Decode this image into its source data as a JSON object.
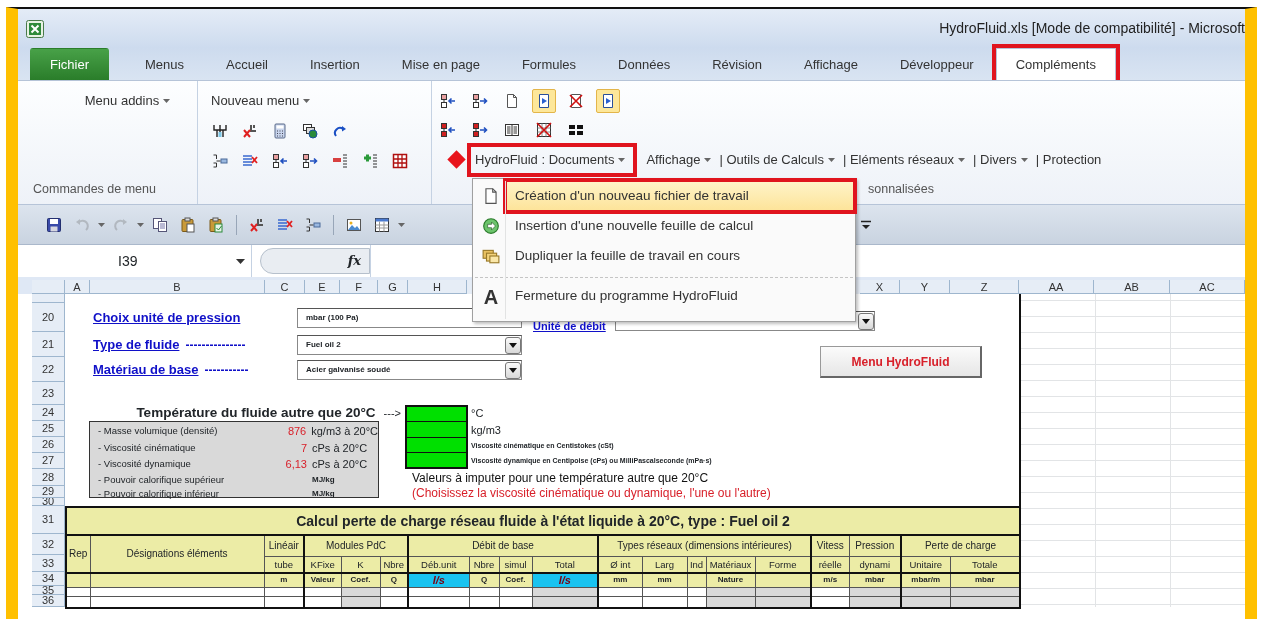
{
  "window": {
    "title": "HydroFluid.xls  [Mode de compatibilité]  -  Microsoft"
  },
  "tabs": [
    {
      "label": "Fichier",
      "kind": "file",
      "selected": false,
      "annotated": false
    },
    {
      "label": "Menus",
      "kind": "tab",
      "selected": false,
      "annotated": false
    },
    {
      "label": "Accueil",
      "kind": "tab",
      "selected": false,
      "annotated": false
    },
    {
      "label": "Insertion",
      "kind": "tab",
      "selected": false,
      "annotated": false
    },
    {
      "label": "Mise en page",
      "kind": "tab",
      "selected": false,
      "annotated": false
    },
    {
      "label": "Formules",
      "kind": "tab",
      "selected": false,
      "annotated": false
    },
    {
      "label": "Données",
      "kind": "tab",
      "selected": false,
      "annotated": false
    },
    {
      "label": "Révision",
      "kind": "tab",
      "selected": false,
      "annotated": false
    },
    {
      "label": "Affichage",
      "kind": "tab",
      "selected": false,
      "annotated": false
    },
    {
      "label": "Développeur",
      "kind": "tab",
      "selected": false,
      "annotated": false
    },
    {
      "label": "Compléments",
      "kind": "tab",
      "selected": true,
      "annotated": true
    }
  ],
  "ribbon": {
    "addins_menu": "Menu addins",
    "group_label": "Commandes de menu",
    "new_menu": "Nouveau menu",
    "new_menu_buttons": [
      [
        {
          "kind": "fork"
        },
        {
          "kind": "cut-pipe"
        },
        {
          "kind": "calculator"
        },
        {
          "kind": "globe"
        },
        {
          "kind": "redo"
        }
      ],
      [
        {
          "kind": "list-arrow"
        },
        {
          "kind": "list-cross"
        },
        {
          "kind": "node-left"
        },
        {
          "kind": "node-right"
        },
        {
          "kind": "list-minus"
        },
        {
          "kind": "list-plus"
        },
        {
          "kind": "table"
        }
      ]
    ],
    "tool_buttons": [
      [
        {
          "kind": "node-left",
          "pressed": false
        },
        {
          "kind": "node-right",
          "pressed": false
        },
        {
          "kind": "page",
          "pressed": false
        },
        {
          "kind": "page-play",
          "pressed": true
        },
        {
          "kind": "page-cross",
          "pressed": false
        },
        {
          "kind": "page-play",
          "pressed": true
        }
      ],
      [
        {
          "kind": "node-left-red",
          "pressed": false
        },
        {
          "kind": "node-right-red",
          "pressed": false
        },
        {
          "kind": "columns",
          "pressed": false
        },
        {
          "kind": "grid-cross",
          "pressed": false
        },
        {
          "kind": "squares",
          "pressed": false
        }
      ]
    ],
    "toolbar_menus": [
      {
        "label": "HydroFluid : Documents",
        "caret": true,
        "annotated": true
      },
      {
        "label": "Affichage",
        "caret": true,
        "annotated": false
      },
      {
        "label": "| Outils de Calculs",
        "caret": true,
        "annotated": false
      },
      {
        "label": "| Eléments réseaux",
        "caret": true,
        "annotated": false
      },
      {
        "label": "| Divers",
        "caret": true,
        "annotated": false
      },
      {
        "label": "| Protection",
        "caret": false,
        "annotated": false
      }
    ],
    "toolbars_label": "sonnalisées"
  },
  "quick_access": [
    {
      "kind": "save",
      "disabled": false
    },
    {
      "kind": "undo",
      "disabled": true
    },
    {
      "kind": "redo",
      "disabled": true
    },
    {
      "kind": "copy",
      "disabled": false
    },
    {
      "kind": "paste",
      "disabled": false
    },
    {
      "kind": "paste-special",
      "disabled": false
    },
    {
      "kind": "separator"
    },
    {
      "kind": "cut-pipe",
      "disabled": false
    },
    {
      "kind": "list-cross",
      "disabled": false
    },
    {
      "kind": "list-arrow",
      "disabled": false
    },
    {
      "kind": "separator"
    },
    {
      "kind": "image",
      "disabled": false
    },
    {
      "kind": "calendar",
      "disabled": false
    }
  ],
  "quick_access_right": [
    {
      "kind": "panes"
    },
    {
      "kind": "customize"
    }
  ],
  "formula_bar": {
    "name_box": "I39",
    "function_label": "fx"
  },
  "context_menu": {
    "items": [
      {
        "label": "Création d'un nouveau fichier de travail",
        "kind": "page",
        "selected": true,
        "annotated": true,
        "separator_before": false
      },
      {
        "label": "Insertion d'une nouvelle feuille de calcul",
        "kind": "insert",
        "selected": false,
        "annotated": false,
        "separator_before": false
      },
      {
        "label": "Dupliquer la feuille de travail en cours",
        "kind": "duplicate",
        "selected": false,
        "annotated": false,
        "separator_before": false
      },
      {
        "label": "Fermeture du programme HydroFluid",
        "kind": "letter",
        "icon_text": "A",
        "selected": false,
        "annotated": false,
        "separator_before": true
      }
    ]
  },
  "sheet": {
    "column_headers": [
      {
        "label": "A",
        "selected": false
      },
      {
        "label": "B",
        "selected": false
      },
      {
        "label": "C",
        "selected": false
      },
      {
        "label": "E",
        "selected": false
      },
      {
        "label": "F",
        "selected": false
      },
      {
        "label": "G",
        "selected": false
      },
      {
        "label": "H",
        "selected": false
      },
      {
        "label": "X",
        "selected": false
      },
      {
        "label": "Y",
        "selected": false
      },
      {
        "label": "Z",
        "selected": false
      },
      {
        "label": "AA",
        "selected": false
      },
      {
        "label": "AB",
        "selected": false
      },
      {
        "label": "AC",
        "selected": false
      }
    ],
    "row_numbers": [
      "20",
      "21",
      "22",
      "23",
      "24",
      "25",
      "26",
      "27",
      "28",
      "29",
      "30",
      "31",
      "32",
      "33",
      "34",
      "35",
      "36"
    ],
    "pressure_unit": {
      "label": "Choix unité de pression",
      "value": "mbar (100 Pa)"
    },
    "flow_unit": {
      "label": "Unité de débit"
    },
    "fluid_type": {
      "label": "Type de fluide",
      "leader": "---------------",
      "value": "Fuel oil 2"
    },
    "base_material": {
      "label": "Matériau de base",
      "leader": "-----------",
      "value": "Acier galvanisé soudé"
    },
    "menu_button": "Menu HydroFluid",
    "temperature": {
      "title": "Température du fluide autre que 20°C",
      "arrow": "--->",
      "units": [
        "°C",
        "kg/m3",
        "Viscosité cinématique en Centistokes (cSt)",
        "Viscosité dynamique en Centipoise (cPs) ou MilliPascalseconde (mPa·s)"
      ]
    },
    "properties": [
      {
        "label": "- Masse volumique (densité)",
        "value": "876",
        "unit": "kg/m3 à 20°C"
      },
      {
        "label": "- Viscosité cinématique",
        "value": "7",
        "unit": "cPs à 20°C"
      },
      {
        "label": "- Viscosité dynamique",
        "value": "6,13",
        "unit": "cPs à 20°C"
      },
      {
        "label": "- Pouvoir calorifique supérieur",
        "unit": "MJ/kg"
      },
      {
        "label": "- Pouvoir calorifique inférieur",
        "unit": "MJ/kg"
      }
    ],
    "notes": [
      {
        "text": "Valeurs à imputer pour une température autre que 20°C",
        "kind": "info"
      },
      {
        "text": "(Choisissez la viscosité cinématique ou dynamique, l'une ou l'autre)",
        "kind": "warning"
      }
    ],
    "table": {
      "title": "Calcul perte de charge réseau fluide à l'état liquide à 20°C,  type : Fuel oil 2",
      "headers_top": [
        "Rep",
        "Désignations éléments",
        "Linéair",
        "Modules PdC",
        "Débit de base",
        "Types réseaux (dimensions intérieures)",
        "Vitess",
        "Pression",
        "Perte de charge"
      ],
      "headers_sub": [
        "tube",
        "KFixe",
        "K",
        "Nbre",
        "Déb.unit",
        "Nbre",
        "simul",
        "Total",
        "Ø int",
        "Larg",
        "Ind",
        "Matériaux",
        "Forme",
        "réelle",
        "dynami",
        "Unitaire",
        "Totale"
      ],
      "units": [
        {
          "kind": "blank"
        },
        {
          "kind": "blank"
        },
        {
          "kind": "unit",
          "text": "m"
        },
        {
          "kind": "unit",
          "text": "Valeur"
        },
        {
          "kind": "unit",
          "text": "Coef."
        },
        {
          "kind": "unit",
          "text": "Q"
        },
        {
          "kind": "flow",
          "text": "l/s"
        },
        {
          "kind": "unit",
          "text": "Q"
        },
        {
          "kind": "unit",
          "text": "Coef."
        },
        {
          "kind": "flow",
          "text": "l/s"
        },
        {
          "kind": "unit",
          "text": "mm"
        },
        {
          "kind": "unit",
          "text": "mm"
        },
        {
          "kind": "blank"
        },
        {
          "kind": "unit",
          "text": "Nature"
        },
        {
          "kind": "blank"
        },
        {
          "kind": "unit",
          "text": "m/s"
        },
        {
          "kind": "unit",
          "text": "mbar"
        },
        {
          "kind": "unit",
          "text": "mbar/m"
        },
        {
          "kind": "unit",
          "text": "mbar"
        }
      ]
    }
  }
}
